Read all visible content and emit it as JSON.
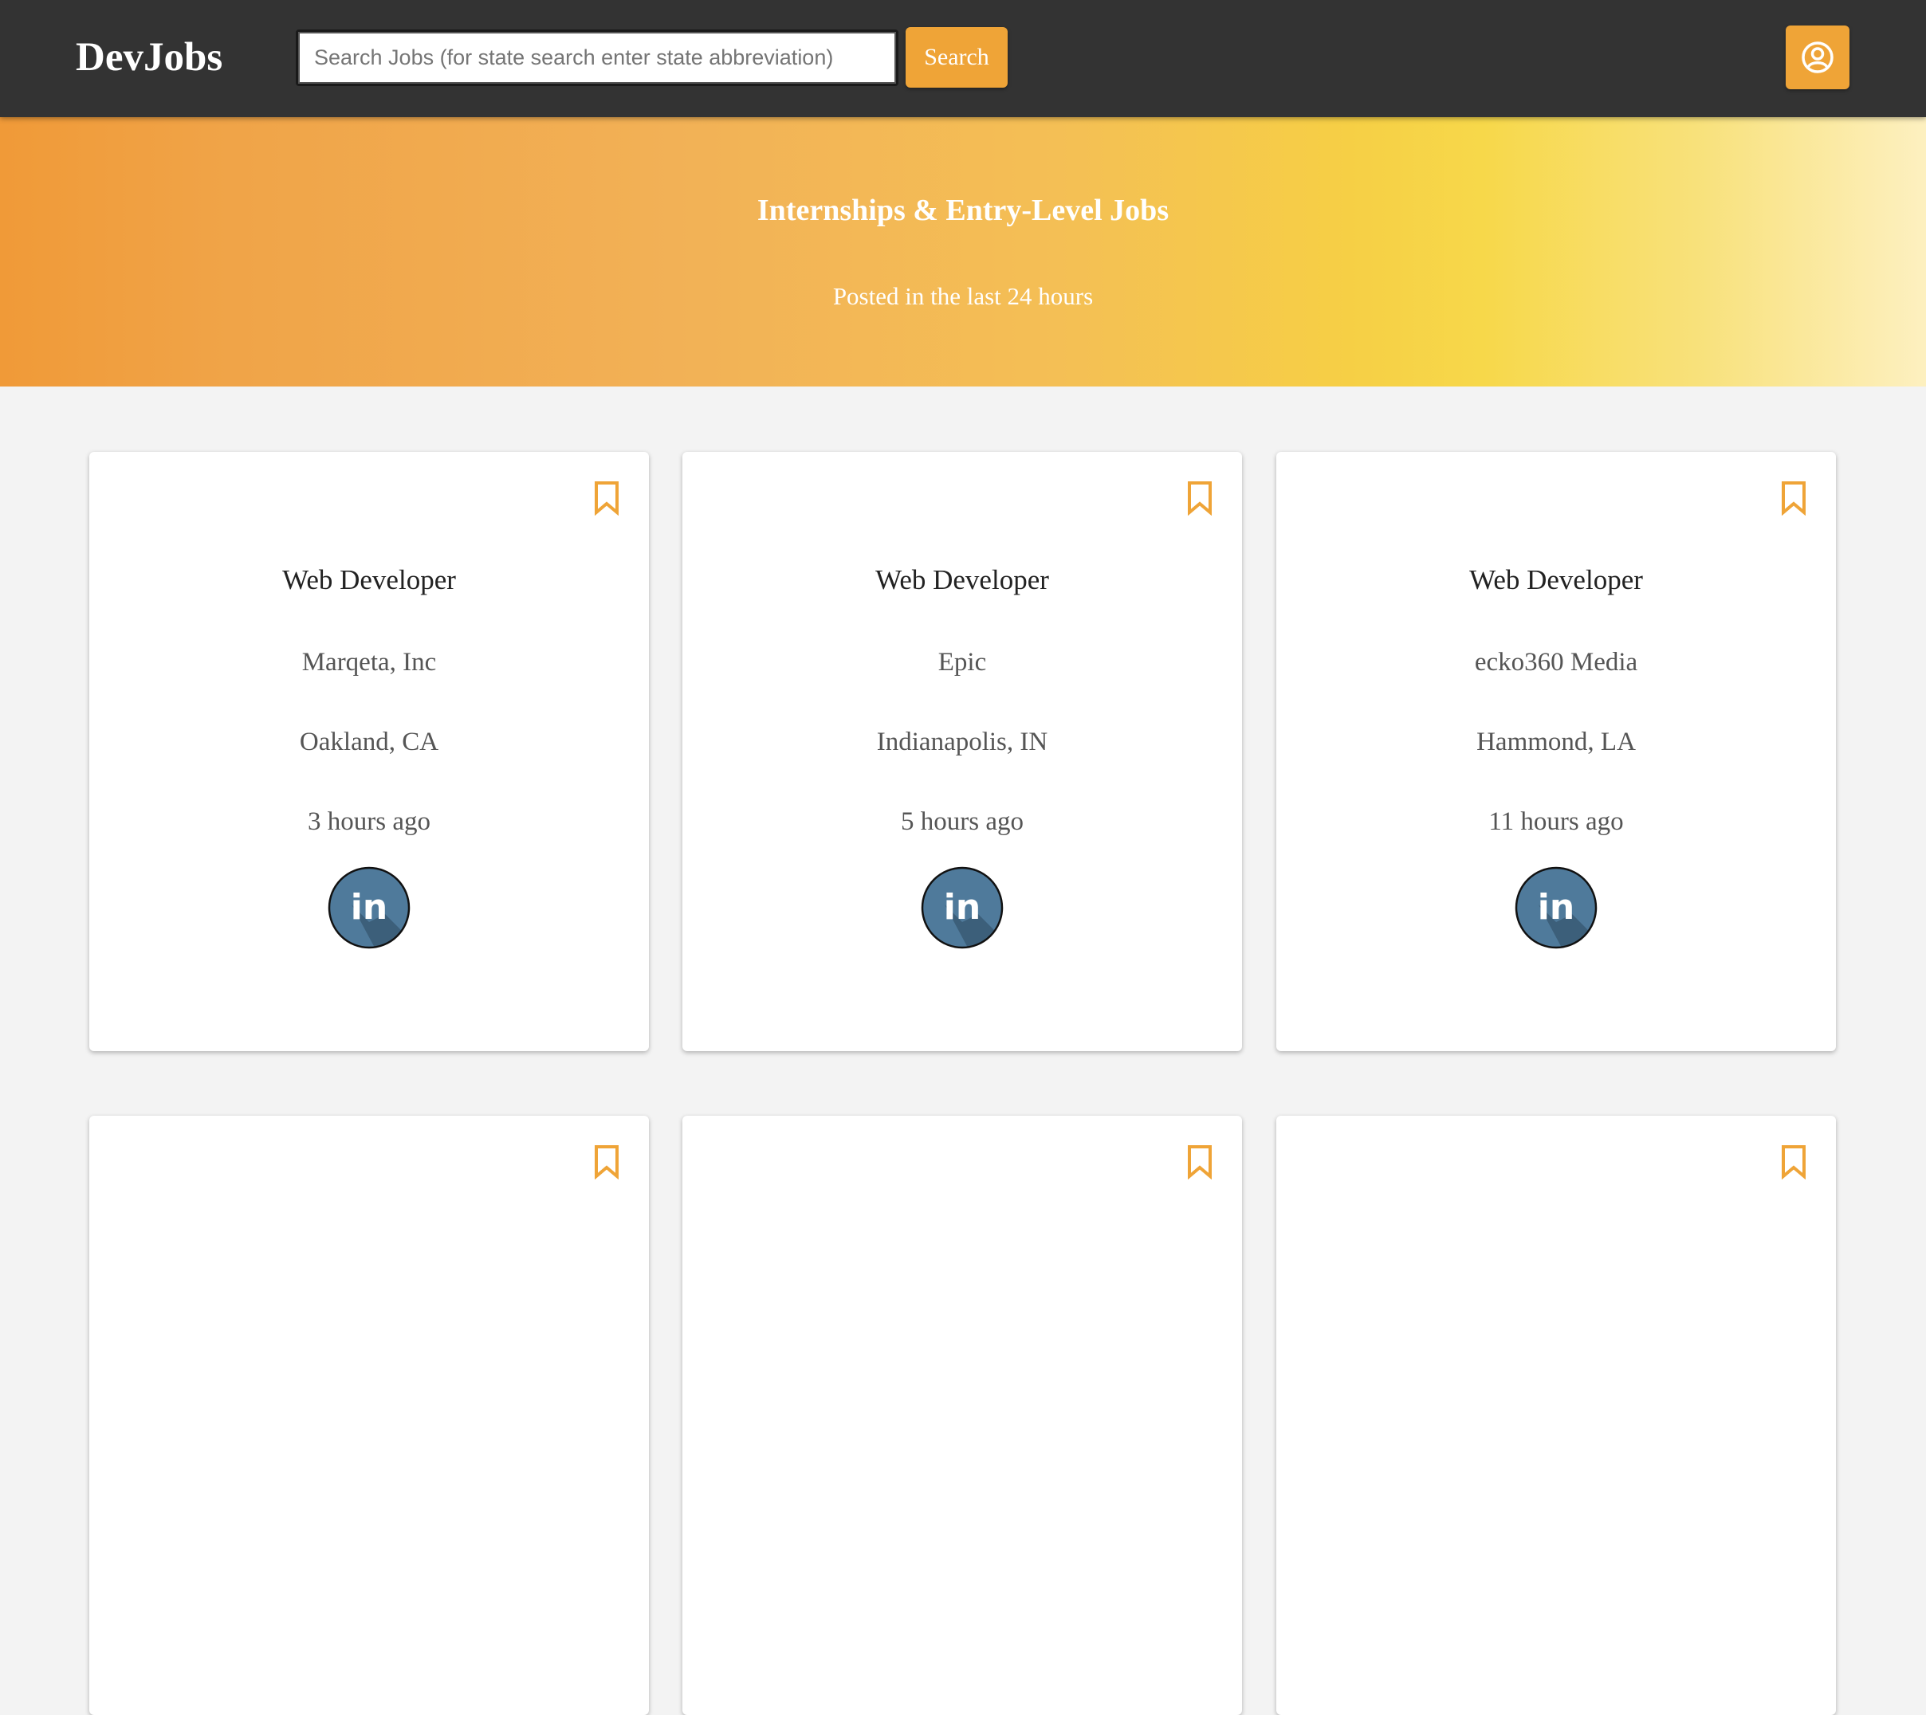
{
  "header": {
    "brand": "DevJobs",
    "search_placeholder": "Search Jobs (for state search enter state abbreviation)",
    "search_value": "",
    "search_button": "Search",
    "account_icon": "user-circle-icon"
  },
  "hero": {
    "title": "Internships & Entry-Level Jobs",
    "subtitle": "Posted in the last 24 hours"
  },
  "jobs": [
    {
      "title": "Web Developer",
      "company": "Marqeta, Inc",
      "location": "Oakland, CA",
      "posted": "3 hours ago"
    },
    {
      "title": "Web Developer",
      "company": "Epic",
      "location": "Indianapolis, IN",
      "posted": "5 hours ago"
    },
    {
      "title": "Web Developer",
      "company": "ecko360 Media",
      "location": "Hammond, LA",
      "posted": "11 hours ago"
    }
  ],
  "icons": {
    "bookmark": "bookmark-icon",
    "linkedin": "linkedin-icon"
  },
  "colors": {
    "header_bg": "#333333",
    "accent": "#efa437",
    "page_bg": "#f3f3f3",
    "linkedin_blue": "#4f7a9b"
  }
}
